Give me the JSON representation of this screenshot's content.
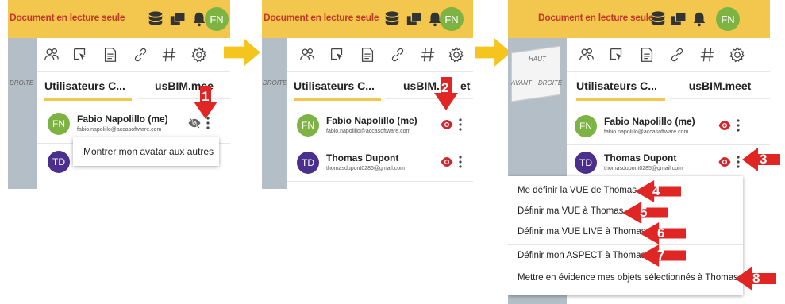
{
  "header": {
    "readonly_label": "Document en lecture seule",
    "avatar_initials": "FN",
    "accent_color": "#f3c64d",
    "alert_color": "#c0392b"
  },
  "tabs": {
    "users": "Utilisateurs C...",
    "users_p1": "Utilisateurs C",
    "meet": "usBIM.meet",
    "meet_p1": "usBIM.mee",
    "meet_p2a": "usBIM.m",
    "meet_p2b": "et"
  },
  "cube": {
    "droite": "DROITE",
    "avant": "AVANT",
    "haut": "HAUT"
  },
  "users": [
    {
      "initials": "FN",
      "name": "Fabio Napolillo (me)",
      "email": "fabio.napolillo@accasoftware.com",
      "color": "#7cb342"
    },
    {
      "initials": "TD",
      "name": "Thomas Dupont",
      "email": "thomasdupont0285@gmail.com",
      "color": "#4a2f8c"
    }
  ],
  "tooltip": {
    "show_avatar": "Montrer mon avatar aux autres"
  },
  "context_menu": {
    "items": [
      "Me définir la VUE de Thomas",
      "Définir ma VUE à Thomas",
      "Définir ma VUE LIVE à Thomas",
      "Définir mon ASPECT à Thomas",
      "Mettre en évidence mes objets sélectionnés à Thomas"
    ]
  },
  "steps": [
    "1",
    "2",
    "3",
    "4",
    "5",
    "6",
    "7",
    "8"
  ],
  "icons": [
    "database-icon",
    "window-icon",
    "bell-icon",
    "users-icon",
    "cursor-box-icon",
    "document-icon",
    "link-icon",
    "hash-icon",
    "settings-icon",
    "eye-icon",
    "eye-off-icon",
    "more-vert-icon"
  ]
}
